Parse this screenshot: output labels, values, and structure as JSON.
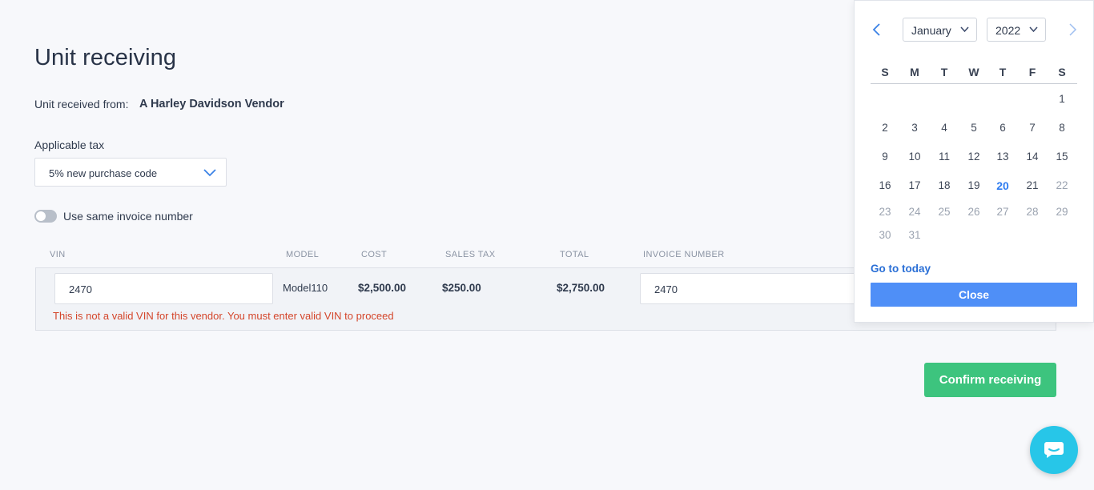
{
  "page": {
    "title": "Unit receiving"
  },
  "received": {
    "label": "Unit received from:",
    "vendor": "A Harley Davidson Vendor"
  },
  "tax": {
    "label": "Applicable tax",
    "selected": "5% new purchase code"
  },
  "toggle": {
    "label": "Use same invoice number",
    "on": false
  },
  "table": {
    "headers": {
      "vin": "VIN",
      "model": "MODEL",
      "cost": "COST",
      "sales_tax": "SALES TAX",
      "total": "TOTAL",
      "invoice": "INVOICE NUMBER"
    },
    "row": {
      "vin": "2470",
      "model": "Model110",
      "cost": "$2,500.00",
      "sales_tax": "$250.00",
      "total": "$2,750.00",
      "invoice": "2470"
    },
    "error": "This is not a valid VIN for this vendor. You must enter valid VIN to proceed"
  },
  "confirm_label": "Confirm receiving",
  "datepicker": {
    "month": "January",
    "year": "2022",
    "weekdays": [
      "S",
      "M",
      "T",
      "W",
      "T",
      "F",
      "S"
    ],
    "days": [
      "1",
      "2",
      "3",
      "4",
      "5",
      "6",
      "7",
      "8",
      "9",
      "10",
      "11",
      "12",
      "13",
      "14",
      "15",
      "16",
      "17",
      "18",
      "19",
      "20",
      "21",
      "22",
      "23",
      "24",
      "25",
      "26",
      "27",
      "28",
      "29",
      "30",
      "31"
    ],
    "today": "20",
    "go_today": "Go to today",
    "close": "Close"
  },
  "colors": {
    "accent_green": "#3dc47e",
    "accent_blue": "#4f8ff7",
    "error_red": "#d4462b",
    "chat": "#27c6e8"
  }
}
